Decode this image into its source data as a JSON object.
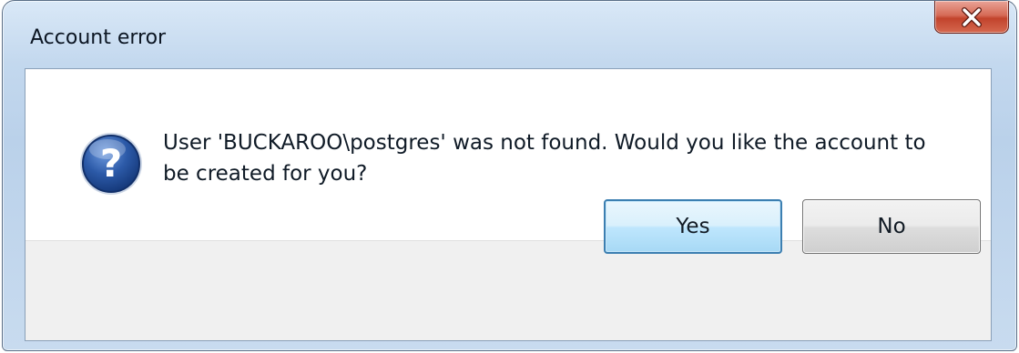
{
  "window": {
    "title": "Account error"
  },
  "titlebar": {
    "close_glyph": "X",
    "close_icon": "close-icon"
  },
  "dialog": {
    "icon": "question-icon",
    "icon_glyph": "?",
    "message": "User 'BUCKAROO\\postgres' was not found. Would you like the account to be created for you?"
  },
  "buttons": {
    "yes_label": "Yes",
    "no_label": "No"
  },
  "colors": {
    "close_button": "#c8493a",
    "default_button_border": "#3c7fb1",
    "icon_blue": "#2c5aa8",
    "button_strip": "#f0f0f0"
  }
}
